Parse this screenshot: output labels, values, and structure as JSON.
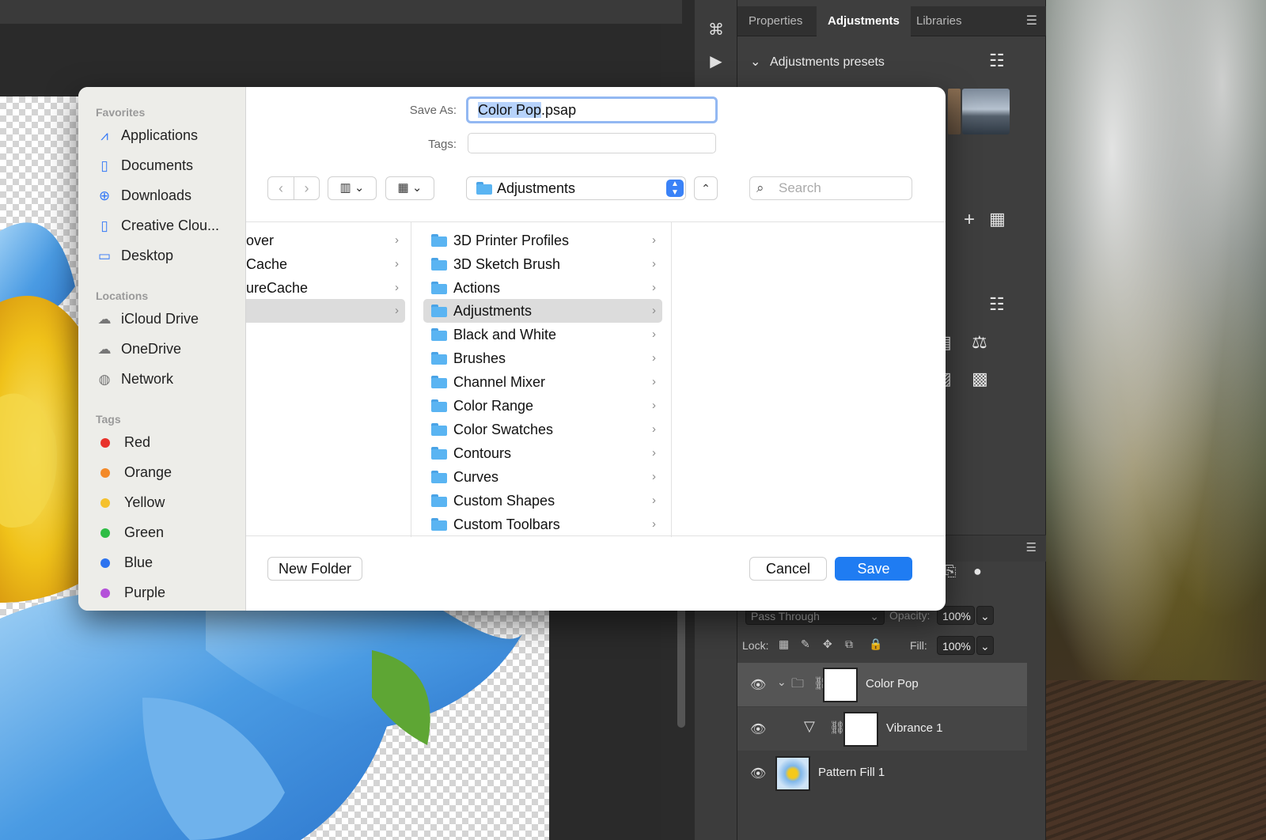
{
  "panel": {
    "tabs": [
      "Properties",
      "Adjustments",
      "Libraries"
    ],
    "active_tab": "Adjustments",
    "presets_title": "Adjustments presets",
    "blend_mode": "Pass Through",
    "opacity_label": "Opacity:",
    "opacity_value": "100%",
    "lock_label": "Lock:",
    "fill_label": "Fill:",
    "fill_value": "100%",
    "layers": [
      {
        "name": "Color Pop",
        "selected": true
      },
      {
        "name": "Vibrance 1",
        "selected": false
      },
      {
        "name": "Pattern Fill 1",
        "selected": false
      }
    ]
  },
  "dialog": {
    "save_as_label": "Save As:",
    "save_as_name": "Color Pop",
    "save_as_ext": ".psap",
    "tags_label": "Tags:",
    "location": "Adjustments",
    "search_placeholder": "Search",
    "sidebar": {
      "favorites_heading": "Favorites",
      "favorites": [
        {
          "label": "Applications",
          "icon": "applications-icon"
        },
        {
          "label": "Documents",
          "icon": "document-icon"
        },
        {
          "label": "Downloads",
          "icon": "downloads-icon"
        },
        {
          "label": "Creative Clou...",
          "icon": "document-icon"
        },
        {
          "label": "Desktop",
          "icon": "desktop-icon"
        }
      ],
      "locations_heading": "Locations",
      "locations": [
        {
          "label": "iCloud Drive",
          "icon": "cloud-icon"
        },
        {
          "label": "OneDrive",
          "icon": "cloud-icon"
        },
        {
          "label": "Network",
          "icon": "network-icon"
        }
      ],
      "tags_heading": "Tags",
      "tags": [
        {
          "label": "Red",
          "color": "#e8322b"
        },
        {
          "label": "Orange",
          "color": "#f38a2a"
        },
        {
          "label": "Yellow",
          "color": "#f5c12e"
        },
        {
          "label": "Green",
          "color": "#2ebd45"
        },
        {
          "label": "Blue",
          "color": "#2c73ef"
        },
        {
          "label": "Purple",
          "color": "#b451d9"
        }
      ]
    },
    "col1_items": [
      "over",
      "Cache",
      "ureCache",
      ""
    ],
    "col2_items": [
      "3D Printer Profiles",
      "3D Sketch Brush",
      "Actions",
      "Adjustments",
      "Black and White",
      "Brushes",
      "Channel Mixer",
      "Color Range",
      "Color Swatches",
      "Contours",
      "Curves",
      "Custom Shapes",
      "Custom Toolbars"
    ],
    "col2_selected": "Adjustments",
    "new_folder_label": "New Folder",
    "cancel_label": "Cancel",
    "save_label": "Save",
    "accent_color": "#1f7cf2"
  }
}
